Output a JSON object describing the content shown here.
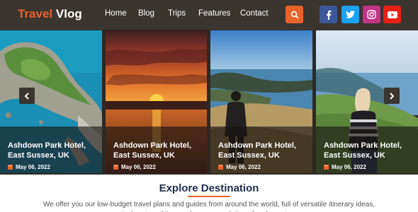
{
  "brand": {
    "part1": "Travel",
    "part2": "Vlog"
  },
  "nav": [
    "Home",
    "Blog",
    "Trips",
    "Features",
    "Contact"
  ],
  "icons": {
    "search": "search-icon",
    "facebook": "facebook-icon",
    "twitter": "twitter-icon",
    "instagram": "instagram-icon",
    "youtube": "youtube-icon",
    "calendar": "calendar-icon",
    "prev": "chevron-left-icon",
    "next": "chevron-right-icon"
  },
  "colors": {
    "accent": "#e8632a",
    "header_bg": "#3b3530",
    "facebook": "#3b5998",
    "twitter": "#1da1f2",
    "instagram": "#c13584",
    "youtube": "#e62117",
    "heading": "#1f2d4d"
  },
  "cards": [
    {
      "title": "Ashdown Park Hotel, East Sussex, UK",
      "date": "May 06, 2022"
    },
    {
      "title": "Ashdown Park Hotel, East Sussex, UK",
      "date": "May 06, 2022"
    },
    {
      "title": "Ashdown Park Hotel, East Sussex, UK",
      "date": "May 06, 2022"
    },
    {
      "title": "Ashdown Park Hotel, East Sussex, UK",
      "date": "May 06, 2022"
    }
  ],
  "section": {
    "title": "Explore Destination",
    "description": "We offer you our low-budget travel plans and guides from around the world, full of versatile itinerary ideas, priceless travel tips, and recommendations for places to go."
  }
}
